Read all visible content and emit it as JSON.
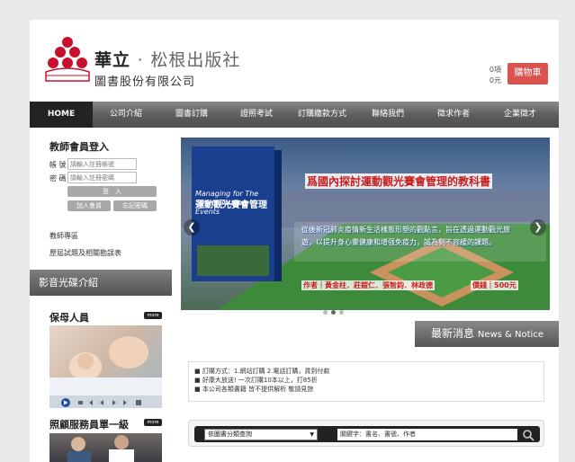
{
  "header": {
    "brand_main": "華立",
    "brand_dot": "·",
    "brand_pub": "松根出版社",
    "brand_sub": "圖書股份有限公司",
    "cart_items": "0項",
    "cart_total": "0元",
    "cart_label": "購物車"
  },
  "nav": {
    "items": [
      "HOME",
      "公司介紹",
      "圖書訂購",
      "證照考試",
      "訂購繳款方式",
      "聯絡我們",
      "徵求作者",
      "企業徵才"
    ]
  },
  "login": {
    "title": "教師會員登入",
    "account_label": "帳 號",
    "account_placeholder": "請輸入註冊帳號",
    "password_label": "密 碼",
    "password_placeholder": "請輸入註冊密碼",
    "login_button": "登　入",
    "join_button": "加入會員",
    "forgot_button": "忘記密碼"
  },
  "links": {
    "teacher_zone": "教師專區",
    "past_exams": "歷屆試題及相關勘誤表"
  },
  "sidebar": {
    "media_title": "影音光碟介紹",
    "section1_title": "保母人員",
    "section2_title": "照顧服務員單一級",
    "more": "more"
  },
  "banner": {
    "headline": "爲國內探討運動觀光賽會管理的教科書",
    "book_title_en": "Managing for The Sports Tourism Events",
    "book_title_zh": "運動觀光賽會管理",
    "description": "從後新冠肺炎疫情新生活樣態形塑的觀點言，旨在透過運動觀光旅遊，以提升身心靈健康和增强免疫力，誠為刻不容緩的課題。",
    "authors": "作者｜黃金柱．莊鎧仁．張智鈞．林政德",
    "price": "價錢｜500元"
  },
  "news": {
    "title_zh": "最新消息",
    "title_en": "News & Notice",
    "items": [
      "訂購方式：1.網站訂購 2.電話訂購，貨到付款",
      "好康大放送! 一次訂購10本以上，打85折",
      "本公司各類書籍 皆不提供解析 敬請見諒"
    ]
  },
  "search": {
    "category_value": "依圖書分類查詢",
    "keyword_placeholder": "關鍵字：書名、書號、作者"
  },
  "colors": {
    "cart": "#d9534f",
    "logo_red": "#c8102e",
    "headline_red": "#c81e1e",
    "banner_blue": "#1e4fa0"
  }
}
